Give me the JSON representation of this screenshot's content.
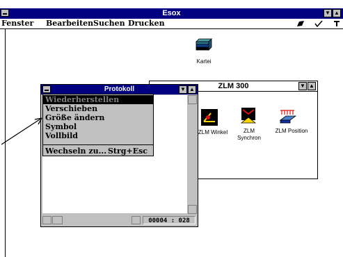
{
  "app": {
    "title": "Esox",
    "menu": [
      {
        "label": "Fenster"
      },
      {
        "label": "Bearbeiten"
      },
      {
        "label": "Suchen"
      },
      {
        "label": "Drucken"
      }
    ],
    "title_buttons": [
      "minimize",
      "maximize"
    ],
    "toolbar_icons": [
      "edit-icon",
      "check-icon",
      "tools-icon"
    ]
  },
  "desktop_icons": [
    {
      "label": "Kartei",
      "icon": "card-file-icon"
    }
  ],
  "group_window": {
    "title": "ZLM 300",
    "items": [
      {
        "label": "ZLM Winkel",
        "icon": "angle-measure-icon"
      },
      {
        "label": "ZLM Synchron",
        "icon": "synchron-icon"
      },
      {
        "label": "ZLM Position",
        "icon": "position-icon"
      }
    ]
  },
  "protokoll": {
    "title": "Protokoll",
    "status_position": "00004 : 028"
  },
  "system_menu": {
    "items": [
      {
        "label": "Wiederherstellen",
        "selected": true,
        "enabled": false
      },
      {
        "label": "Verschieben"
      },
      {
        "label": "Größe ändern"
      },
      {
        "label": "Symbol"
      },
      {
        "label": "Vollbild"
      },
      {
        "label": "Wechseln zu...",
        "shortcut": "Strg+Esc"
      }
    ]
  },
  "colors": {
    "active_title": "#000080",
    "window_face": "#c0c0c0",
    "menu_highlight": "#000000"
  }
}
